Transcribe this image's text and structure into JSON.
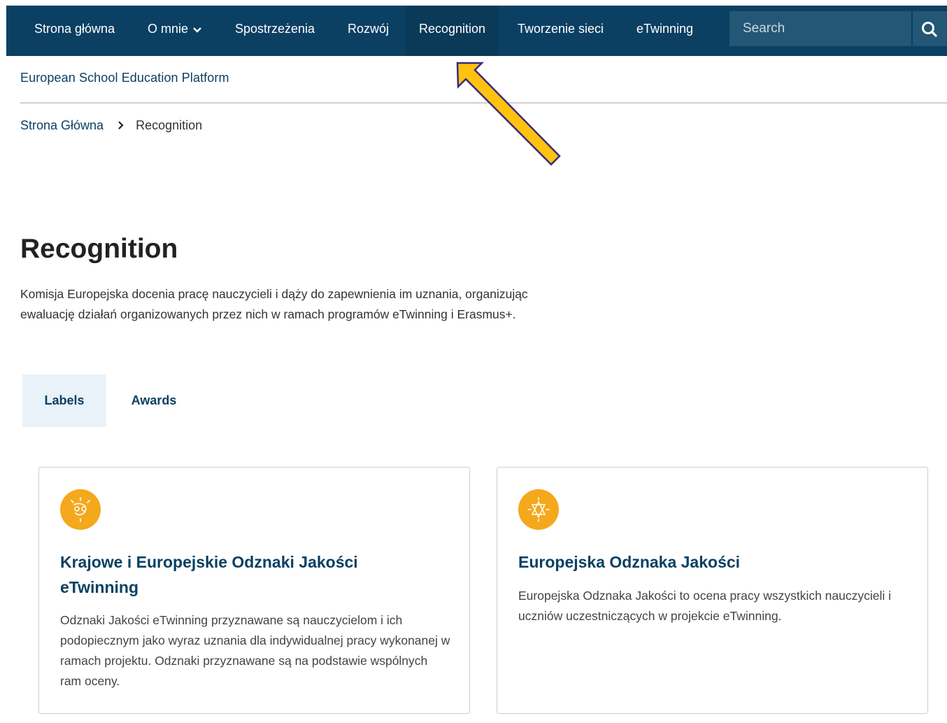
{
  "nav": {
    "items": [
      {
        "label": "Strona główna"
      },
      {
        "label": "O mnie"
      },
      {
        "label": "Spostrzeżenia"
      },
      {
        "label": "Rozwój"
      },
      {
        "label": "Recognition"
      },
      {
        "label": "Tworzenie sieci"
      },
      {
        "label": "eTwinning"
      }
    ],
    "search_placeholder": "Search"
  },
  "brand": "European School Education Platform",
  "breadcrumb": {
    "home": "Strona Główna",
    "current": "Recognition"
  },
  "page": {
    "title": "Recognition",
    "intro_line1": "Komisja Europejska docenia pracę nauczycieli i dąży do zapewnienia im uznania, organizując",
    "intro_line2": "ewaluację działań organizowanych przez nich w ramach programów eTwinning i Erasmus+."
  },
  "tabs": [
    {
      "label": "Labels"
    },
    {
      "label": "Awards"
    }
  ],
  "cards": [
    {
      "title_line1": "Krajowe i Europejskie Odznaki Jakości",
      "title_line2": "eTwinning",
      "text": "Odznaki Jakości eTwinning przyznawane są nauczycielom i ich podopiecznym jako wyraz uznania dla indywidualnej pracy wykonanej w ramach projektu. Odznaki przyznawane są na podstawie wspólnych ram oceny."
    },
    {
      "title_line1": "Europejska Odznaka Jakości",
      "text": "Europejska Odznaka Jakości to ocena pracy wszystkich nauczycieli i uczniów uczestniczących w projekcie eTwinning."
    }
  ],
  "colors": {
    "navbar": "#0b4063",
    "accent_icon": "#f4a81c",
    "annotation_arrow": "#ffc20e"
  }
}
